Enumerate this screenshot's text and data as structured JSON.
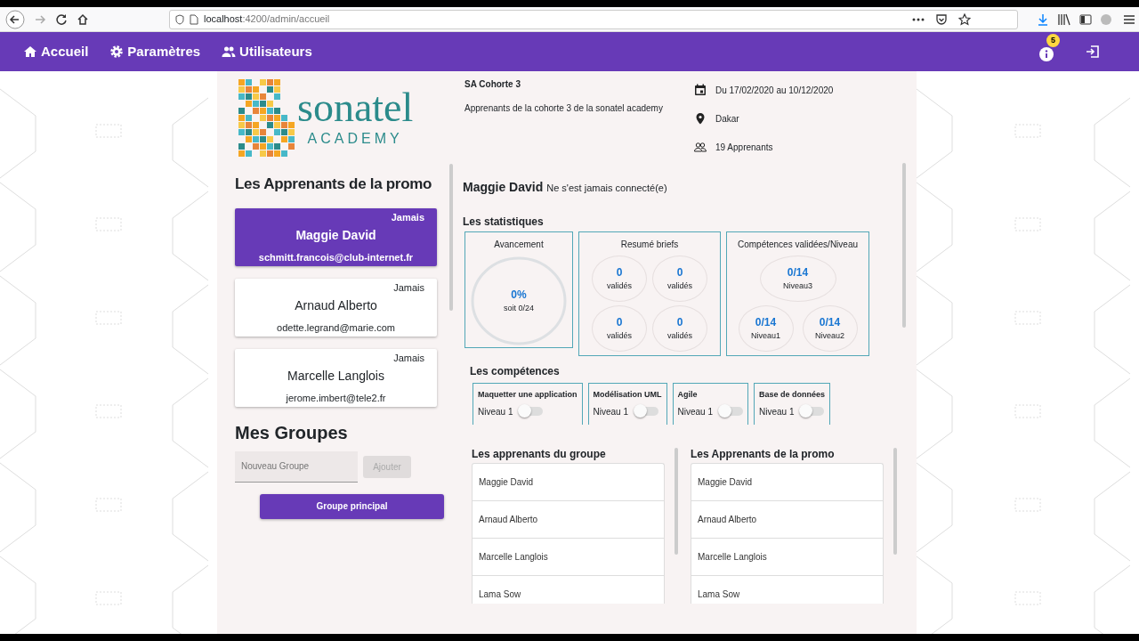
{
  "browser": {
    "url_host": "localhost",
    "url_rest": ":4200/admin/accueil"
  },
  "nav": {
    "items": [
      {
        "label": "Accueil"
      },
      {
        "label": "Paramètres"
      },
      {
        "label": "Utilisateurs"
      }
    ],
    "badge": "5"
  },
  "logo": {
    "word": "sonatel",
    "sub": "ACADEMY"
  },
  "cohort": {
    "title": "SA Cohorte 3",
    "description": "Apprenants de la cohorte 3 de la sonatel academy",
    "dates": "Du 17/02/2020 au 10/12/2020",
    "location": "Dakar",
    "count": "19 Apprenants"
  },
  "learners": {
    "title": "Les Apprenants de la promo",
    "items": [
      {
        "status": "Jamais",
        "name": "Maggie David",
        "email": "schmitt.francois@club-internet.fr",
        "selected": true
      },
      {
        "status": "Jamais",
        "name": "Arnaud Alberto",
        "email": "odette.legrand@marie.com",
        "selected": false
      },
      {
        "status": "Jamais",
        "name": "Marcelle Langlois",
        "email": "jerome.imbert@tele2.fr",
        "selected": false
      }
    ]
  },
  "groups": {
    "title": "Mes Groupes",
    "input": {
      "placeholder": "Nouveau Groupe"
    },
    "add_button": {
      "label": "Ajouter",
      "disabled": true
    },
    "main_button": "Groupe principal"
  },
  "detail": {
    "name": "Maggie David",
    "status": "Ne s'est jamais connecté(e)"
  },
  "stats": {
    "title": "Les statistiques",
    "progress": {
      "title": "Avancement",
      "value": "0%",
      "sub": "soit 0/24"
    },
    "briefs": {
      "title": "Resumé briefs",
      "items": [
        {
          "value": "0",
          "label": "validés"
        },
        {
          "value": "0",
          "label": "validés"
        },
        {
          "value": "0",
          "label": "validés"
        },
        {
          "value": "0",
          "label": "validés"
        }
      ]
    },
    "levels": {
      "title": "Compétences validées/Niveau",
      "items": [
        {
          "value": "0/14",
          "label": "Niveau3"
        },
        {
          "value": "0/14",
          "label": "Niveau1"
        },
        {
          "value": "0/14",
          "label": "Niveau2"
        }
      ]
    }
  },
  "competences": {
    "title": "Les compétences",
    "items": [
      {
        "name": "Maquetter une application",
        "levels": [
          {
            "label": "Niveau 1",
            "checked": false
          }
        ]
      },
      {
        "name": "Modélisation UML",
        "levels": [
          {
            "label": "Niveau 1",
            "checked": false
          }
        ]
      },
      {
        "name": "Agile",
        "levels": [
          {
            "label": "Niveau 1",
            "checked": false
          }
        ]
      },
      {
        "name": "Base de données",
        "levels": [
          {
            "label": "Niveau 1",
            "checked": false
          }
        ]
      }
    ]
  },
  "lists": [
    {
      "title": "Les apprenants du groupe",
      "items": [
        "Maggie David",
        "Arnaud Alberto",
        "Marcelle Langlois",
        "Lama Sow"
      ]
    },
    {
      "title": "Les Apprenants de la promo",
      "items": [
        "Maggie David",
        "Arnaud Alberto",
        "Marcelle Langlois",
        "Lama Sow"
      ]
    }
  ]
}
